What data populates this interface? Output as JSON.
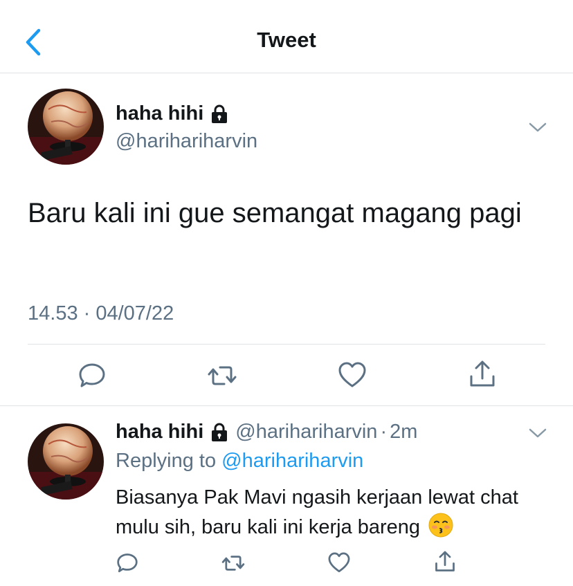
{
  "header": {
    "title": "Tweet",
    "back_icon": "chevron-left-icon",
    "accent_color": "#1d9bf0"
  },
  "main_tweet": {
    "display_name": "haha hihi",
    "handle": "@harihariharvin",
    "text": "Baru kali ini gue semangat magang pagi",
    "timestamp": "14.53 · 04/07/22",
    "actions": [
      "reply-icon",
      "retweet-icon",
      "like-icon",
      "share-icon"
    ]
  },
  "reply_tweet": {
    "display_name": "haha hihi",
    "handle": "@harihariharvin",
    "dot": "·",
    "time": "2m",
    "replying_label": "Replying to",
    "replying_to": "@harihariharvin",
    "text": "Biasanya Pak Mavi ngasih kerjaan lewat chat mulu sih, baru kali ini kerja bareng",
    "emoji": "kissing-face-emoji",
    "actions": [
      "reply-icon",
      "retweet-icon",
      "like-icon",
      "share-icon"
    ]
  },
  "colors": {
    "text_primary": "#14171a",
    "text_secondary": "#5b7083",
    "divider": "#dfe3e6"
  }
}
